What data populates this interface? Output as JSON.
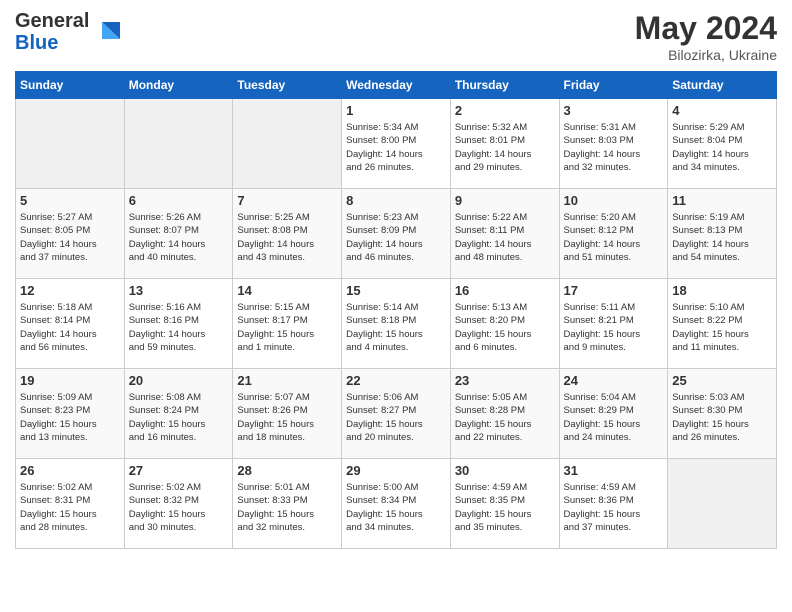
{
  "logo": {
    "general": "General",
    "blue": "Blue"
  },
  "title": "May 2024",
  "location": "Bilozirka, Ukraine",
  "days_header": [
    "Sunday",
    "Monday",
    "Tuesday",
    "Wednesday",
    "Thursday",
    "Friday",
    "Saturday"
  ],
  "weeks": [
    [
      {
        "day": "",
        "info": ""
      },
      {
        "day": "",
        "info": ""
      },
      {
        "day": "",
        "info": ""
      },
      {
        "day": "1",
        "info": "Sunrise: 5:34 AM\nSunset: 8:00 PM\nDaylight: 14 hours\nand 26 minutes."
      },
      {
        "day": "2",
        "info": "Sunrise: 5:32 AM\nSunset: 8:01 PM\nDaylight: 14 hours\nand 29 minutes."
      },
      {
        "day": "3",
        "info": "Sunrise: 5:31 AM\nSunset: 8:03 PM\nDaylight: 14 hours\nand 32 minutes."
      },
      {
        "day": "4",
        "info": "Sunrise: 5:29 AM\nSunset: 8:04 PM\nDaylight: 14 hours\nand 34 minutes."
      }
    ],
    [
      {
        "day": "5",
        "info": "Sunrise: 5:27 AM\nSunset: 8:05 PM\nDaylight: 14 hours\nand 37 minutes."
      },
      {
        "day": "6",
        "info": "Sunrise: 5:26 AM\nSunset: 8:07 PM\nDaylight: 14 hours\nand 40 minutes."
      },
      {
        "day": "7",
        "info": "Sunrise: 5:25 AM\nSunset: 8:08 PM\nDaylight: 14 hours\nand 43 minutes."
      },
      {
        "day": "8",
        "info": "Sunrise: 5:23 AM\nSunset: 8:09 PM\nDaylight: 14 hours\nand 46 minutes."
      },
      {
        "day": "9",
        "info": "Sunrise: 5:22 AM\nSunset: 8:11 PM\nDaylight: 14 hours\nand 48 minutes."
      },
      {
        "day": "10",
        "info": "Sunrise: 5:20 AM\nSunset: 8:12 PM\nDaylight: 14 hours\nand 51 minutes."
      },
      {
        "day": "11",
        "info": "Sunrise: 5:19 AM\nSunset: 8:13 PM\nDaylight: 14 hours\nand 54 minutes."
      }
    ],
    [
      {
        "day": "12",
        "info": "Sunrise: 5:18 AM\nSunset: 8:14 PM\nDaylight: 14 hours\nand 56 minutes."
      },
      {
        "day": "13",
        "info": "Sunrise: 5:16 AM\nSunset: 8:16 PM\nDaylight: 14 hours\nand 59 minutes."
      },
      {
        "day": "14",
        "info": "Sunrise: 5:15 AM\nSunset: 8:17 PM\nDaylight: 15 hours\nand 1 minute."
      },
      {
        "day": "15",
        "info": "Sunrise: 5:14 AM\nSunset: 8:18 PM\nDaylight: 15 hours\nand 4 minutes."
      },
      {
        "day": "16",
        "info": "Sunrise: 5:13 AM\nSunset: 8:20 PM\nDaylight: 15 hours\nand 6 minutes."
      },
      {
        "day": "17",
        "info": "Sunrise: 5:11 AM\nSunset: 8:21 PM\nDaylight: 15 hours\nand 9 minutes."
      },
      {
        "day": "18",
        "info": "Sunrise: 5:10 AM\nSunset: 8:22 PM\nDaylight: 15 hours\nand 11 minutes."
      }
    ],
    [
      {
        "day": "19",
        "info": "Sunrise: 5:09 AM\nSunset: 8:23 PM\nDaylight: 15 hours\nand 13 minutes."
      },
      {
        "day": "20",
        "info": "Sunrise: 5:08 AM\nSunset: 8:24 PM\nDaylight: 15 hours\nand 16 minutes."
      },
      {
        "day": "21",
        "info": "Sunrise: 5:07 AM\nSunset: 8:26 PM\nDaylight: 15 hours\nand 18 minutes."
      },
      {
        "day": "22",
        "info": "Sunrise: 5:06 AM\nSunset: 8:27 PM\nDaylight: 15 hours\nand 20 minutes."
      },
      {
        "day": "23",
        "info": "Sunrise: 5:05 AM\nSunset: 8:28 PM\nDaylight: 15 hours\nand 22 minutes."
      },
      {
        "day": "24",
        "info": "Sunrise: 5:04 AM\nSunset: 8:29 PM\nDaylight: 15 hours\nand 24 minutes."
      },
      {
        "day": "25",
        "info": "Sunrise: 5:03 AM\nSunset: 8:30 PM\nDaylight: 15 hours\nand 26 minutes."
      }
    ],
    [
      {
        "day": "26",
        "info": "Sunrise: 5:02 AM\nSunset: 8:31 PM\nDaylight: 15 hours\nand 28 minutes."
      },
      {
        "day": "27",
        "info": "Sunrise: 5:02 AM\nSunset: 8:32 PM\nDaylight: 15 hours\nand 30 minutes."
      },
      {
        "day": "28",
        "info": "Sunrise: 5:01 AM\nSunset: 8:33 PM\nDaylight: 15 hours\nand 32 minutes."
      },
      {
        "day": "29",
        "info": "Sunrise: 5:00 AM\nSunset: 8:34 PM\nDaylight: 15 hours\nand 34 minutes."
      },
      {
        "day": "30",
        "info": "Sunrise: 4:59 AM\nSunset: 8:35 PM\nDaylight: 15 hours\nand 35 minutes."
      },
      {
        "day": "31",
        "info": "Sunrise: 4:59 AM\nSunset: 8:36 PM\nDaylight: 15 hours\nand 37 minutes."
      },
      {
        "day": "",
        "info": ""
      }
    ]
  ]
}
